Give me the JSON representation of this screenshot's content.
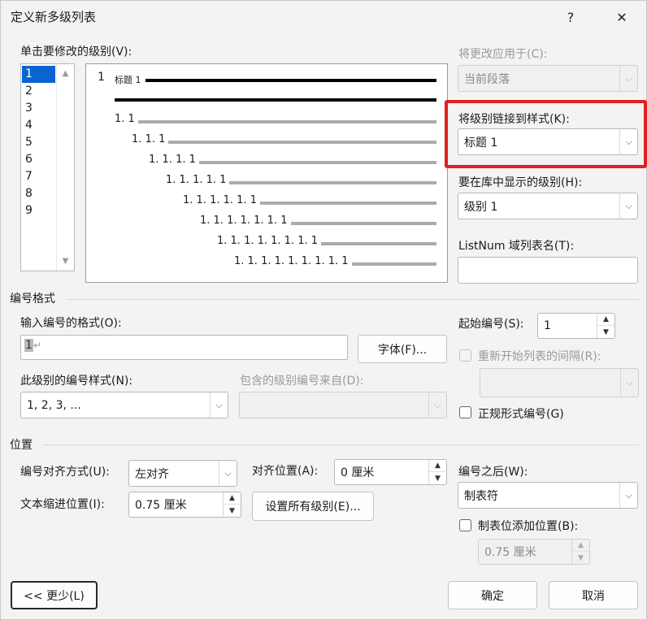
{
  "dialog": {
    "title": "定义新多级列表",
    "help_glyph": "?",
    "close_glyph": "✕"
  },
  "level_list": {
    "label": "单击要修改的级别(V):",
    "items": [
      "1",
      "2",
      "3",
      "4",
      "5",
      "6",
      "7",
      "8",
      "9"
    ],
    "selected": "1"
  },
  "preview": {
    "heading_number": "1",
    "heading_style": "标题 1",
    "lines": [
      "1. 1",
      "1. 1. 1",
      "1. 1. 1. 1",
      "1. 1. 1. 1. 1",
      "1. 1. 1. 1. 1. 1",
      "1. 1. 1. 1. 1. 1. 1",
      "1. 1. 1. 1. 1. 1. 1. 1",
      "1. 1. 1. 1. 1. 1. 1. 1. 1"
    ]
  },
  "right_panel": {
    "apply_to_label": "将更改应用于(C):",
    "apply_to_value": "当前段落",
    "link_style_label": "将级别链接到样式(K):",
    "link_style_value": "标题 1",
    "gallery_level_label": "要在库中显示的级别(H):",
    "gallery_level_value": "级别 1",
    "listnum_label": "ListNum 域列表名(T):",
    "listnum_value": ""
  },
  "number_format": {
    "section_title": "编号格式",
    "format_label": "输入编号的格式(O):",
    "format_value": "1",
    "format_mark": "↵",
    "font_button": "字体(F)...",
    "style_label": "此级别的编号样式(N):",
    "style_value": "1, 2, 3, ...",
    "include_label": "包含的级别编号来自(D):",
    "include_value": "",
    "start_at_label": "起始编号(S):",
    "start_at_value": "1",
    "restart_label": "重新开始列表的间隔(R):",
    "restart_value": "",
    "legal_label": "正规形式编号(G)"
  },
  "position": {
    "section_title": "位置",
    "alignment_label": "编号对齐方式(U):",
    "alignment_value": "左对齐",
    "aligned_at_label": "对齐位置(A):",
    "aligned_at_value": "0 厘米",
    "indent_label": "文本缩进位置(I):",
    "indent_value": "0.75 厘米",
    "set_all_button": "设置所有级别(E)...",
    "follow_label": "编号之后(W):",
    "follow_value": "制表符",
    "tab_stop_label": "制表位添加位置(B):",
    "tab_stop_value": "0.75 厘米"
  },
  "footer": {
    "less_button": "<< 更少(L)",
    "ok_button": "确定",
    "cancel_button": "取消"
  },
  "colors": {
    "selection": "#0a64d0",
    "highlight_border": "#e02020"
  }
}
